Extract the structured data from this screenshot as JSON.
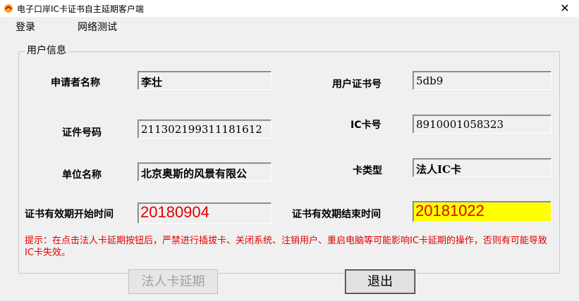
{
  "window": {
    "title": "电子口岸IC卡证书自主延期客户端",
    "close_glyph": "✕"
  },
  "menu": {
    "items": [
      "登录",
      "网络测试"
    ]
  },
  "group": {
    "title": "用户信息"
  },
  "fields": {
    "applicant_name": {
      "label": "申请者名称",
      "value": "李壮"
    },
    "cert_number": {
      "label": "用户证书号",
      "value": "5db9"
    },
    "id_number": {
      "label": "证件号码",
      "value": "21130219931118161​2"
    },
    "ic_card": {
      "label": "IC卡号",
      "value": "8910001058323"
    },
    "org_name": {
      "label": "单位名称",
      "value": "北京奥斯的风景有限公"
    },
    "card_type": {
      "label": "卡类型",
      "value": "法人IC卡"
    },
    "valid_start": {
      "label": "证书有效期开始时间",
      "value": "20180904"
    },
    "valid_end": {
      "label": "证书有效期结束时间",
      "value": "20181022"
    }
  },
  "hint": "提示：在点击法人卡延期按钮后，严禁进行插拔卡、关闭系统、注销用户、重启电脑等可能影响IC卡延期的操作，否则有可能导致IC卡失效。",
  "buttons": {
    "extend": "法人卡延期",
    "exit": "退出"
  },
  "colors": {
    "highlight": "#ffff00",
    "date_text": "#e00000",
    "hint_text": "#e00000"
  }
}
